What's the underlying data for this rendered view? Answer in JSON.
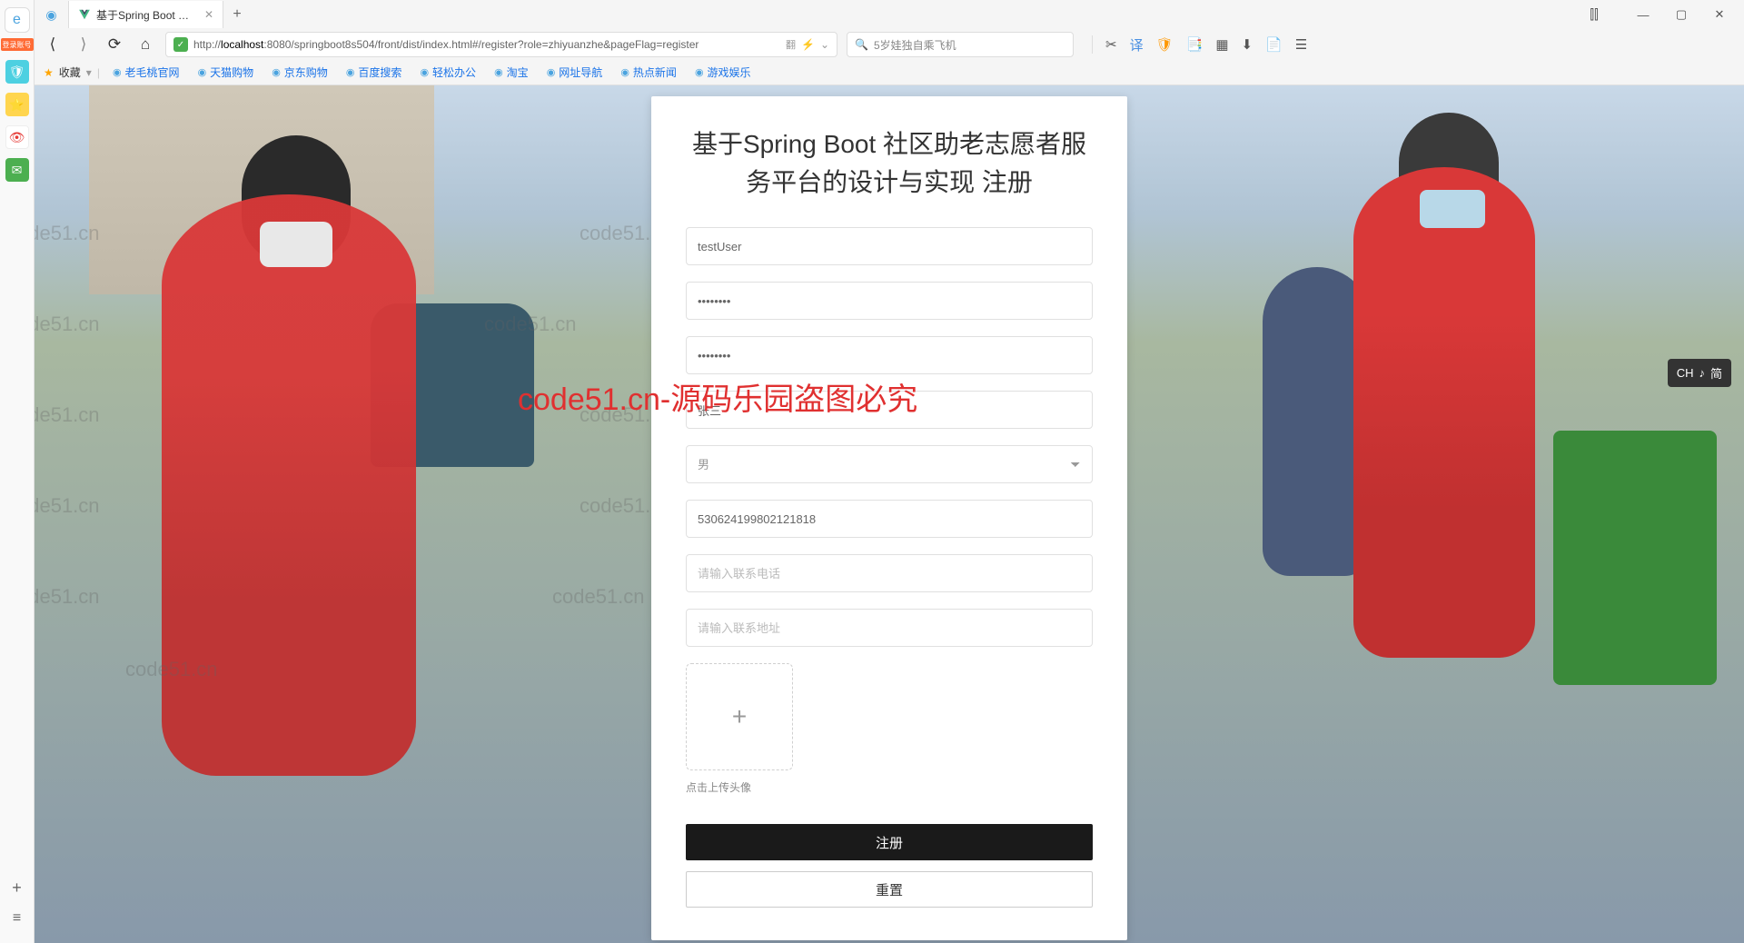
{
  "sidebar": {
    "login_label": "登录账号",
    "icons": [
      "🛡",
      "⭐",
      "👁",
      "✉"
    ]
  },
  "tab": {
    "title": "基于Spring Boot 社区助老志愿"
  },
  "nav": {
    "back": "⟨",
    "forward": "⟩"
  },
  "url": {
    "prefix": "http://",
    "host": "localhost",
    "path": ":8080/springboot8s504/front/dist/index.html#/register?role=zhiyuanzhe&pageFlag=register",
    "translate": "翻",
    "bolt": "⚡"
  },
  "search": {
    "placeholder": "5岁娃独自乘飞机",
    "icon": "🔍"
  },
  "toolbar_icons": [
    "✂",
    "译",
    "🛡",
    "📑",
    "▦",
    "⬇",
    "📄",
    "☰"
  ],
  "bookmarks": {
    "label": "收藏",
    "items": [
      "老毛桃官网",
      "天猫购物",
      "京东购物",
      "百度搜索",
      "轻松办公",
      "淘宝",
      "网址导航",
      "热点新闻",
      "游戏娱乐"
    ]
  },
  "watermark_text": "code51.cn",
  "red_watermark": "code51.cn-源码乐园盗图必究",
  "form": {
    "title": "基于Spring Boot 社区助老志愿者服务平台的设计与实现 注册",
    "username": "testUser",
    "password": "••••••••",
    "confirm": "••••••••",
    "realname": "张三",
    "gender": "男",
    "idcard": "530624199802121818",
    "phone_placeholder": "请输入联系电话",
    "address_placeholder": "请输入联系地址",
    "upload_hint": "点击上传头像",
    "register_btn": "注册",
    "reset_btn": "重置"
  },
  "ime": {
    "left": "CH",
    "mid": "♪",
    "right": "简"
  }
}
